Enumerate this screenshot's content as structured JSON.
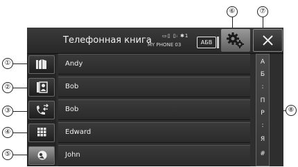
{
  "header": {
    "title": "Телефонная книга",
    "status_icons": "▭▯ ▯ᵢ ✱1",
    "device_name": "MY PHONE 03",
    "abc_label": "АБВ"
  },
  "icons": {
    "phonebook": "phonebook-icon",
    "contact_card": "contact-card-icon",
    "call_history": "call-history-icon",
    "keypad": "keypad-icon",
    "favorites": "favorites-icon",
    "settings": "gear-icon",
    "close": "close-icon"
  },
  "contacts": [
    "Andy",
    "Bob",
    "Bob",
    "Edward",
    "John"
  ],
  "alphabet_index": [
    "А",
    "Б",
    ":",
    "П",
    "Р",
    ":",
    "Я",
    "#"
  ],
  "callouts": [
    "①",
    "②",
    "③",
    "④",
    "⑤",
    "⑥",
    "⑦",
    "⑧"
  ],
  "colors": {
    "background": "#2e2e2e",
    "text": "#f0f0f0",
    "border": "#666666"
  }
}
